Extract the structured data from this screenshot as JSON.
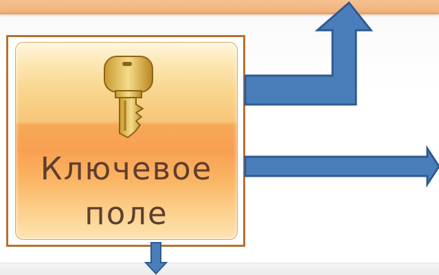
{
  "key_button": {
    "icon": "key-icon",
    "label_line1": "Ключевое",
    "label_line2": "поле"
  },
  "colors": {
    "arrow_fill": "#4a7ebb",
    "arrow_stroke": "#2e5a8f",
    "button_border": "#b5702f",
    "top_bar": "#f0b27e"
  }
}
